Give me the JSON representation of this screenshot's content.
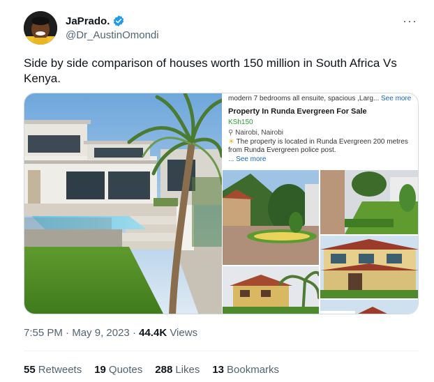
{
  "author": {
    "display_name": "JaPrado.",
    "handle": "@Dr_AustinOmondi"
  },
  "tweet": {
    "text": "Side by side comparison of houses worth 150 million in South Africa Vs Kenya."
  },
  "listing_card": {
    "line1": "modern 7 bedrooms all ensuite, spacious ,Larg...",
    "line1_more": "See more",
    "title": "Property In Runda Evergreen For Sale",
    "price": "KSh150",
    "location": "Nairobi, Nairobi",
    "description": "The property is located in Runda Evergreen 200 metres from Runda Evergreen police post.",
    "see_more": "... See more"
  },
  "meta": {
    "time": "7:55 PM",
    "separator": "·",
    "date": "May 9, 2023",
    "views_count": "44.4K",
    "views_label": "Views"
  },
  "stats": {
    "retweets_count": "55",
    "retweets_label": "Retweets",
    "quotes_count": "19",
    "quotes_label": "Quotes",
    "likes_count": "288",
    "likes_label": "Likes",
    "bookmarks_count": "13",
    "bookmarks_label": "Bookmarks"
  },
  "icons": {
    "verified": "verified-badge-icon",
    "more": "more-options-icon",
    "location": "location-pin-icon",
    "sun": "sun-icon"
  },
  "colors": {
    "verified_blue": "#1d9bf0",
    "secondary_text": "#536471",
    "price_green": "#2e9a3a",
    "link_blue": "#1565c0"
  }
}
